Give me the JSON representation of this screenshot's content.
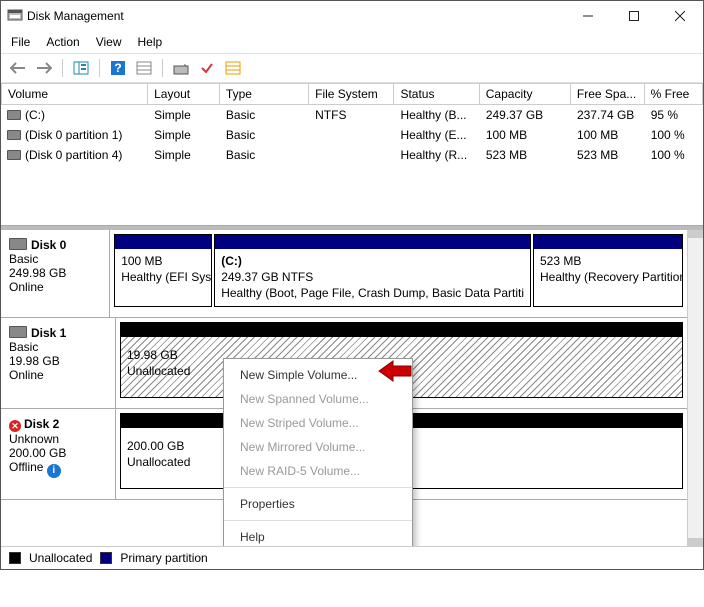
{
  "window": {
    "title": "Disk Management"
  },
  "menus": {
    "file": "File",
    "action": "Action",
    "view": "View",
    "help": "Help"
  },
  "columns": {
    "volume": "Volume",
    "layout": "Layout",
    "type": "Type",
    "fs": "File System",
    "status": "Status",
    "capacity": "Capacity",
    "free": "Free Spa...",
    "pctfree": "% Free"
  },
  "volumes": [
    {
      "name": "(C:)",
      "layout": "Simple",
      "type": "Basic",
      "fs": "NTFS",
      "status": "Healthy (B...",
      "capacity": "249.37 GB",
      "free": "237.74 GB",
      "pct": "95 %"
    },
    {
      "name": "(Disk 0 partition 1)",
      "layout": "Simple",
      "type": "Basic",
      "fs": "",
      "status": "Healthy (E...",
      "capacity": "100 MB",
      "free": "100 MB",
      "pct": "100 %"
    },
    {
      "name": "(Disk 0 partition 4)",
      "layout": "Simple",
      "type": "Basic",
      "fs": "",
      "status": "Healthy (R...",
      "capacity": "523 MB",
      "free": "523 MB",
      "pct": "100 %"
    }
  ],
  "disks": {
    "d0": {
      "name": "Disk 0",
      "type": "Basic",
      "size": "249.98 GB",
      "state": "Online",
      "p1": {
        "line1": "100 MB",
        "line2": "Healthy (EFI Syster"
      },
      "p2": {
        "title": "(C:)",
        "line1": "249.37 GB NTFS",
        "line2": "Healthy (Boot, Page File, Crash Dump, Basic Data Partiti"
      },
      "p3": {
        "line1": "523 MB",
        "line2": "Healthy (Recovery Partition"
      }
    },
    "d1": {
      "name": "Disk 1",
      "type": "Basic",
      "size": "19.98 GB",
      "state": "Online",
      "p1": {
        "line1": "19.98 GB",
        "line2": "Unallocated"
      }
    },
    "d2": {
      "name": "Disk 2",
      "type": "Unknown",
      "size": "200.00 GB",
      "state": "Offline",
      "p1": {
        "line1": "200.00 GB",
        "line2": "Unallocated"
      }
    }
  },
  "ctx": {
    "new_simple": "New Simple Volume...",
    "new_spanned": "New Spanned Volume...",
    "new_striped": "New Striped Volume...",
    "new_mirrored": "New Mirrored Volume...",
    "new_raid5": "New RAID-5 Volume...",
    "properties": "Properties",
    "help": "Help"
  },
  "legend": {
    "unalloc": "Unallocated",
    "primary": "Primary partition"
  }
}
